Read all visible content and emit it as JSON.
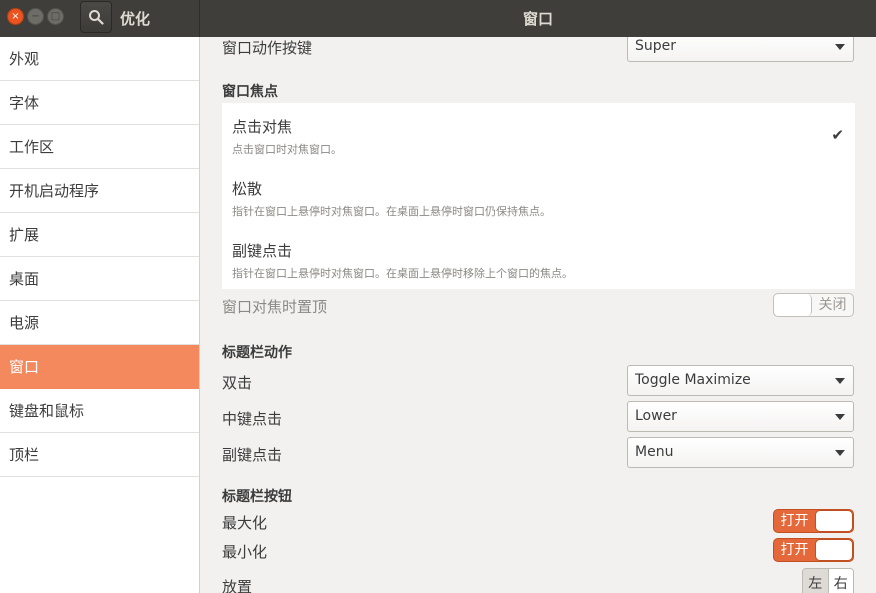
{
  "app_title": "优化",
  "window_title": "窗口",
  "window_buttons": {
    "close_icon": "×",
    "min_icon": "−",
    "max_icon": "□"
  },
  "sidebar": {
    "items": [
      {
        "label": "外观"
      },
      {
        "label": "字体"
      },
      {
        "label": "工作区"
      },
      {
        "label": "开机启动程序"
      },
      {
        "label": "扩展"
      },
      {
        "label": "桌面"
      },
      {
        "label": "电源"
      },
      {
        "label": "窗口"
      },
      {
        "label": "键盘和鼠标"
      },
      {
        "label": "顶栏"
      }
    ],
    "active_index": 7
  },
  "main": {
    "action_key": {
      "label": "窗口动作按键",
      "value": "Super"
    },
    "focus_section": {
      "title": "窗口焦点",
      "items": [
        {
          "title": "点击对焦",
          "desc": "点击窗口时对焦窗口。",
          "selected": true
        },
        {
          "title": "松散",
          "desc": "指针在窗口上悬停时对焦窗口。在桌面上悬停时窗口仍保持焦点。"
        },
        {
          "title": "副键点击",
          "desc": "指针在窗口上悬停时对焦窗口。在桌面上悬停时移除上个窗口的焦点。"
        }
      ],
      "check_icon": "✔"
    },
    "raise_on_focus": {
      "label": "窗口对焦时置顶",
      "state": "关闭"
    },
    "titlebar_actions": {
      "title": "标题栏动作",
      "double_click": {
        "label": "双击",
        "value": "Toggle Maximize"
      },
      "middle_click": {
        "label": "中键点击",
        "value": "Lower"
      },
      "secondary_click": {
        "label": "副键点击",
        "value": "Menu"
      }
    },
    "titlebar_buttons": {
      "title": "标题栏按钮",
      "maximize": {
        "label": "最大化",
        "state": "打开"
      },
      "minimize": {
        "label": "最小化",
        "state": "打开"
      },
      "placement": {
        "label": "放置",
        "left": "左",
        "right": "右"
      }
    }
  },
  "colors": {
    "accent": "#f4895e",
    "switch_on": "#e5683a",
    "titlebar": "#3f3e3a"
  }
}
